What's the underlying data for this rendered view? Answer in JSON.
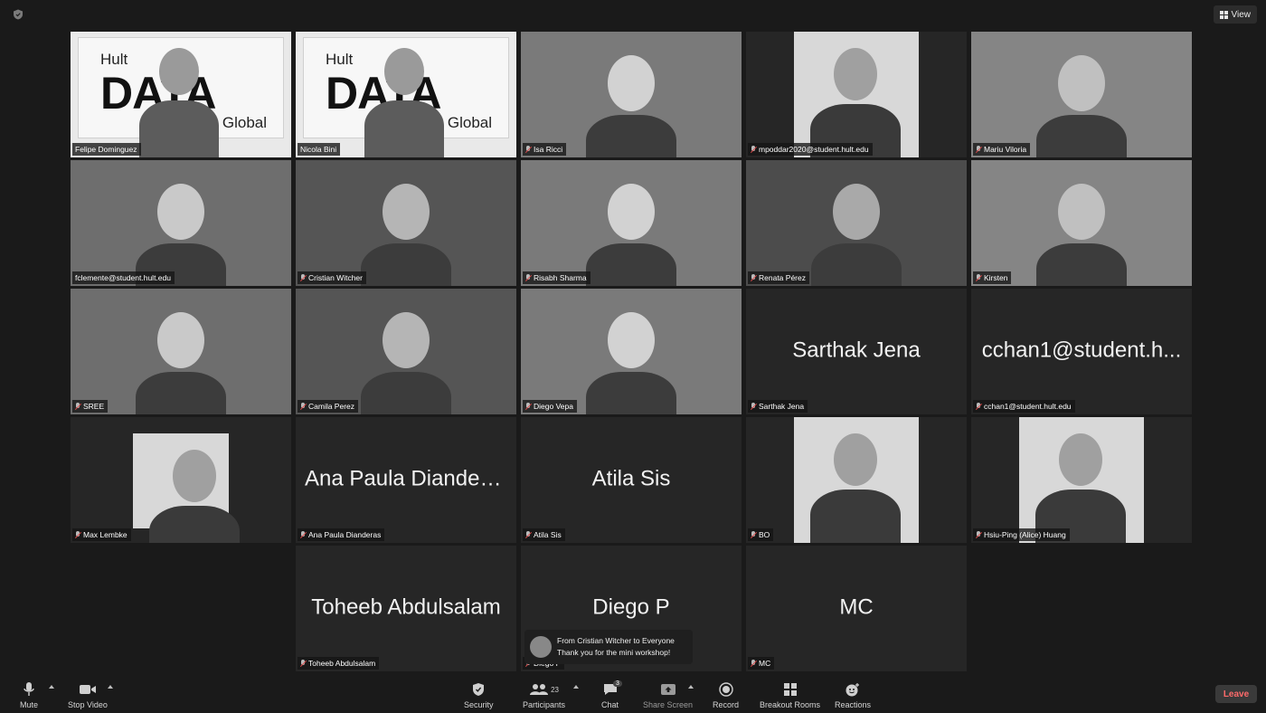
{
  "window": {
    "view_label": "View"
  },
  "tiles": [
    {
      "name": "Felipe Dominguez",
      "type": "hult"
    },
    {
      "name": "Nicola Bini",
      "type": "hult"
    },
    {
      "name": "Isa Ricci",
      "type": "video",
      "muted": true
    },
    {
      "name": "mpoddar2020@student.hult.edu",
      "type": "portrait",
      "muted": true
    },
    {
      "name": "Mariu Viloria",
      "type": "video",
      "muted": true
    },
    {
      "name": "fclemente@student.hult.edu",
      "type": "video"
    },
    {
      "name": "Cristian Witcher",
      "type": "video",
      "muted": true
    },
    {
      "name": "Risabh Sharma",
      "type": "video",
      "muted": true
    },
    {
      "name": "Renata Pérez",
      "type": "video",
      "muted": true
    },
    {
      "name": "Kirsten",
      "type": "video",
      "muted": true
    },
    {
      "name": "SREE",
      "type": "video",
      "muted": true
    },
    {
      "name": "Camila Perez",
      "type": "video",
      "muted": true
    },
    {
      "name": "Diego Vepa",
      "type": "video",
      "muted": true
    },
    {
      "name": "Sarthak Jena",
      "type": "name",
      "display": "Sarthak Jena",
      "muted": true
    },
    {
      "name": "cchan1@student.hult.edu",
      "type": "name",
      "display": "cchan1@student.h...",
      "muted": true
    },
    {
      "name": "Max Lembke",
      "type": "portrait",
      "muted": true
    },
    {
      "name": "Ana Paula Dianderas",
      "type": "name",
      "display": "Ana Paula Dianderas",
      "muted": true
    },
    {
      "name": "Atila Sis",
      "type": "name",
      "display": "Atila Sis",
      "muted": true
    },
    {
      "name": "BO",
      "type": "portrait",
      "muted": true
    },
    {
      "name": "Hsiu-Ping (Alice) Huang",
      "type": "portrait",
      "muted": true
    },
    {
      "name": "Toheeb Abdulsalam",
      "type": "name",
      "display": "Toheeb Abdulsalam",
      "muted": true
    },
    {
      "name": "Diego P",
      "type": "name",
      "display": "Diego P",
      "muted": true
    },
    {
      "name": "MC",
      "type": "name",
      "display": "MC",
      "muted": true
    }
  ],
  "hult_logo": {
    "line1": "Hult",
    "line2": "DATA",
    "line3": "Global"
  },
  "chat_toast": {
    "from": "From Cristian Witcher to Everyone",
    "message": "Thank you for the mini workshop!"
  },
  "toolbar": {
    "mute": "Mute",
    "stop_video": "Stop Video",
    "security": "Security",
    "participants": "Participants",
    "participants_count": "23",
    "chat": "Chat",
    "chat_badge": "3",
    "share_screen": "Share Screen",
    "record": "Record",
    "breakout_rooms": "Breakout Rooms",
    "reactions": "Reactions",
    "leave": "Leave"
  },
  "colors": {
    "leave_text": "#ff6b6b",
    "background": "#1a1a1a",
    "tile_bg": "#262626"
  }
}
